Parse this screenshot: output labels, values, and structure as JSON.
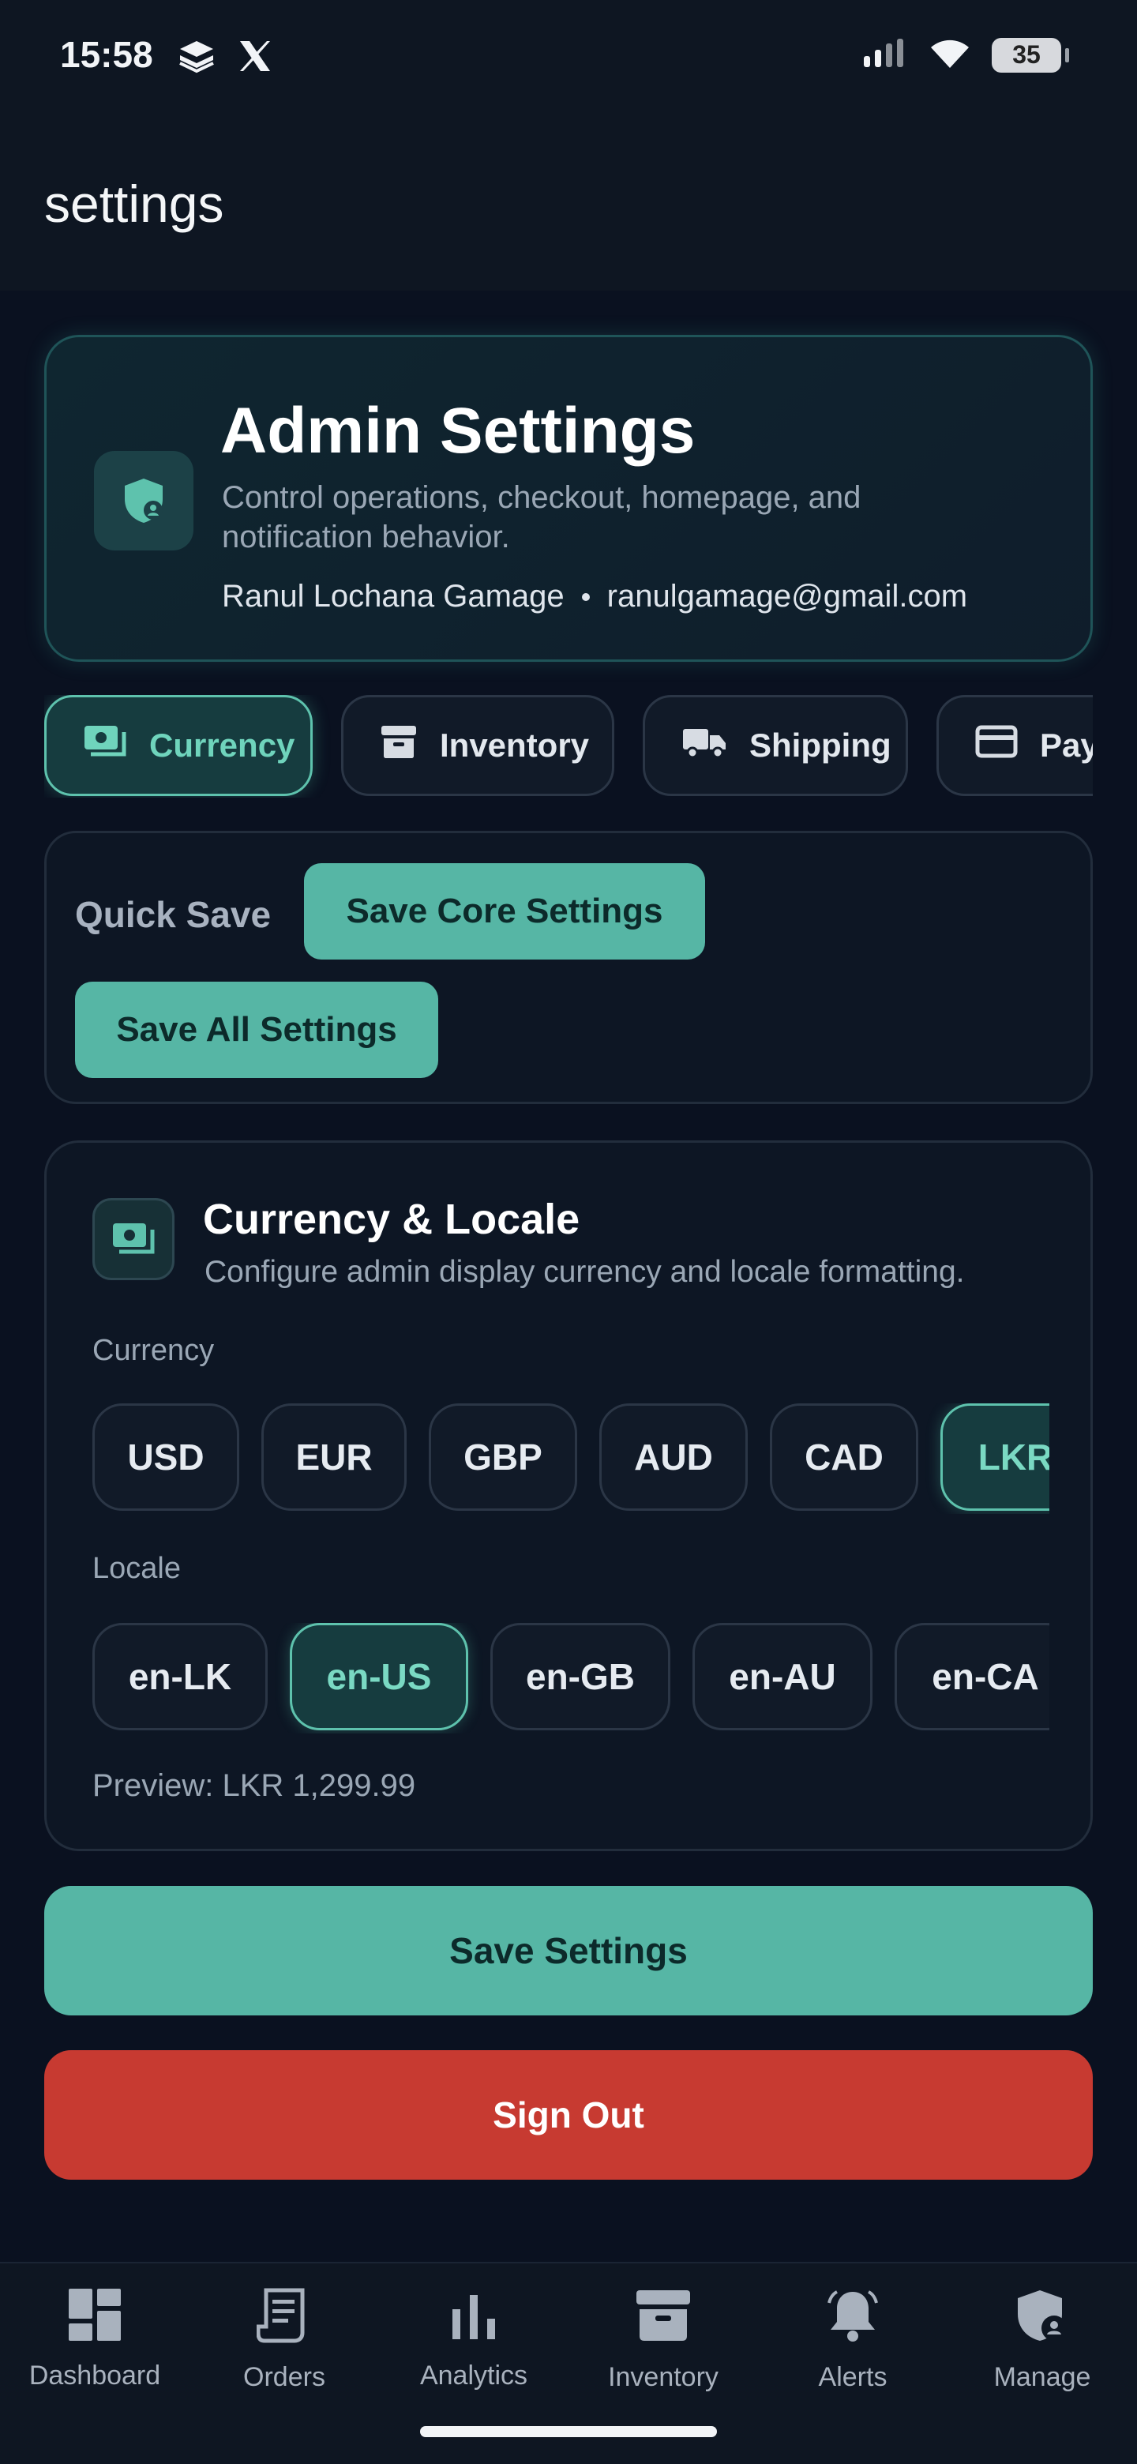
{
  "status_bar": {
    "time": "15:58",
    "battery": "35"
  },
  "app_bar": {
    "title": "settings"
  },
  "hero": {
    "title": "Admin Settings",
    "description": "Control operations, checkout, homepage, and notification behavior.",
    "user_name": "Ranul Lochana Gamage",
    "user_email": "ranulgamage@gmail.com"
  },
  "tabs": [
    {
      "label": "Currency",
      "icon": "banknote-icon",
      "active": true
    },
    {
      "label": "Inventory",
      "icon": "archive-icon",
      "active": false
    },
    {
      "label": "Shipping",
      "icon": "truck-icon",
      "active": false
    },
    {
      "label": "Payments",
      "icon": "credit-card-icon",
      "active": false
    }
  ],
  "quick_save": {
    "label": "Quick Save",
    "save_core": "Save Core Settings",
    "save_all": "Save All Settings"
  },
  "currency_card": {
    "title": "Currency & Locale",
    "description": "Configure admin display currency and locale formatting.",
    "currency_label": "Currency",
    "currencies": [
      "USD",
      "EUR",
      "GBP",
      "AUD",
      "CAD",
      "LKR"
    ],
    "selected_currency": "LKR",
    "locale_label": "Locale",
    "locales": [
      "en-LK",
      "en-US",
      "en-GB",
      "en-AU",
      "en-CA"
    ],
    "selected_locale": "en-US",
    "preview": "Preview: LKR 1,299.99"
  },
  "actions": {
    "save": "Save Settings",
    "sign_out": "Sign Out"
  },
  "bottom_nav": [
    {
      "label": "Dashboard",
      "icon": "dashboard-icon"
    },
    {
      "label": "Orders",
      "icon": "receipt-icon"
    },
    {
      "label": "Analytics",
      "icon": "bar-chart-icon"
    },
    {
      "label": "Inventory",
      "icon": "archive-icon"
    },
    {
      "label": "Alerts",
      "icon": "bell-icon"
    },
    {
      "label": "Manage",
      "icon": "admin-shield-icon"
    }
  ],
  "colors": {
    "accent": "#56b6a5",
    "danger": "#c73a31",
    "background": "#0a1120"
  }
}
